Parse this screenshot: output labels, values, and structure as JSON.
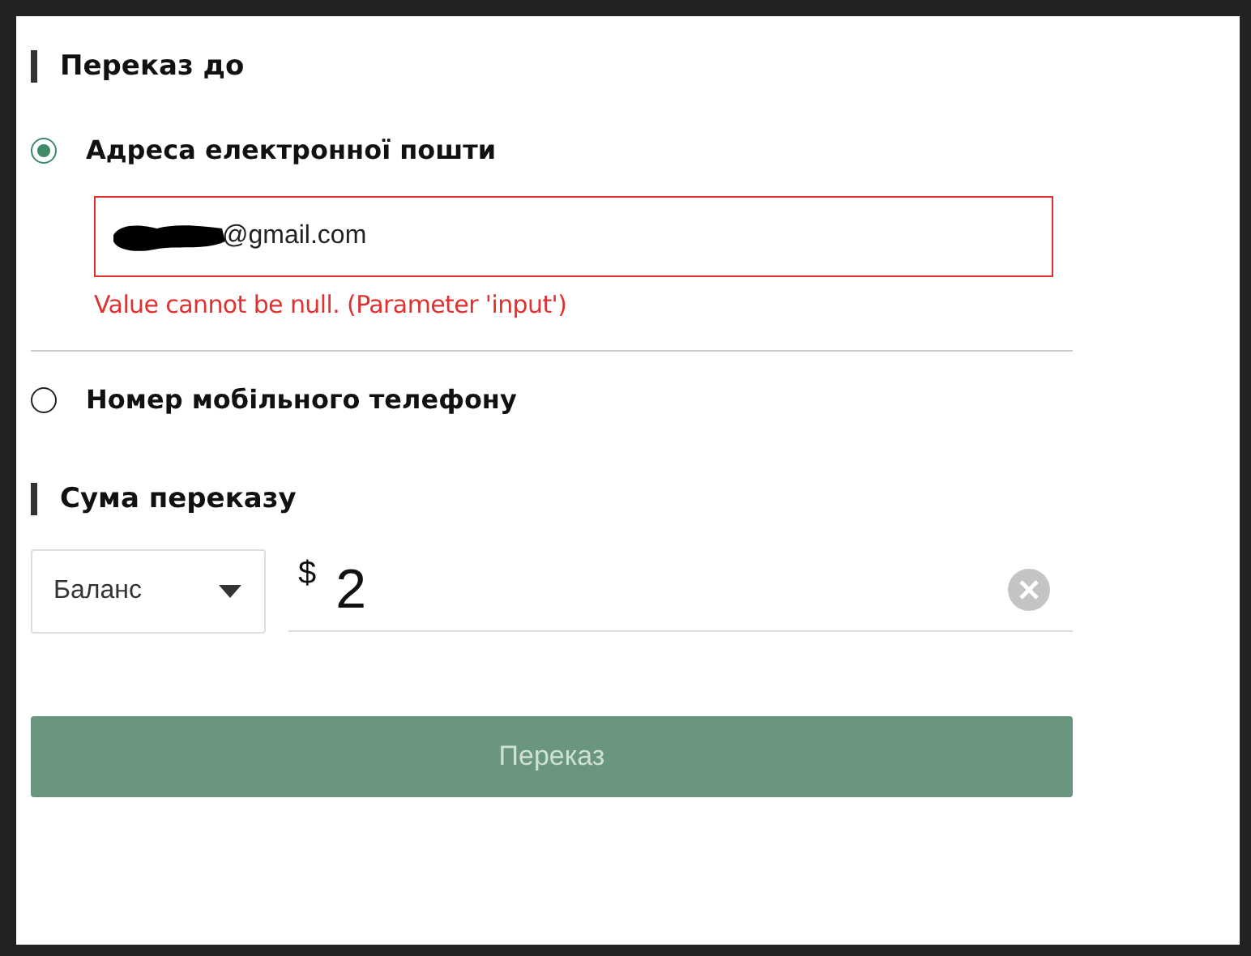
{
  "transfer_to": {
    "title": "Переказ до",
    "options": [
      {
        "label": "Адреса електронної пошти",
        "selected": true,
        "field": {
          "value": "@gmail.com",
          "error": true
        },
        "error_message": "Value cannot be null. (Parameter 'input')"
      },
      {
        "label": "Номер мобільного телефону",
        "selected": false
      }
    ]
  },
  "amount": {
    "title": "Сума переказу",
    "source": {
      "value": "Баланс"
    },
    "currency": "$",
    "value": "2"
  },
  "submit": {
    "label": "Переказ",
    "disabled": true
  }
}
